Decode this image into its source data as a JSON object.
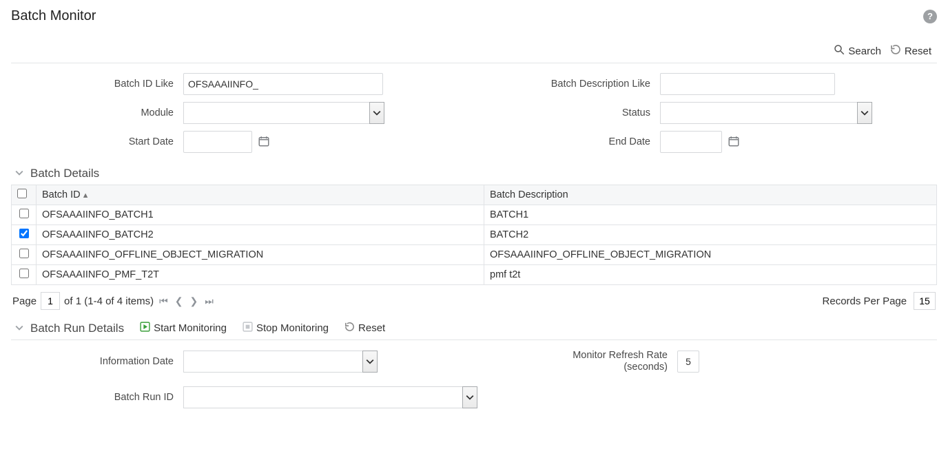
{
  "page": {
    "title": "Batch Monitor",
    "help_tooltip": "?"
  },
  "toolbar": {
    "search_label": "Search",
    "reset_label": "Reset"
  },
  "filters": {
    "batch_id_like_label": "Batch ID Like",
    "batch_id_like_value": "OFSAAAIINFO_",
    "batch_desc_like_label": "Batch Description Like",
    "batch_desc_like_value": "",
    "module_label": "Module",
    "module_value": "",
    "status_label": "Status",
    "status_value": "",
    "start_date_label": "Start Date",
    "start_date_value": "",
    "end_date_label": "End Date",
    "end_date_value": ""
  },
  "batch_details": {
    "title": "Batch Details",
    "columns": {
      "batch_id": "Batch ID",
      "batch_desc": "Batch Description"
    },
    "rows": [
      {
        "checked": false,
        "batch_id": "OFSAAAIINFO_BATCH1",
        "batch_desc": "BATCH1"
      },
      {
        "checked": true,
        "batch_id": "OFSAAAIINFO_BATCH2",
        "batch_desc": "BATCH2"
      },
      {
        "checked": false,
        "batch_id": "OFSAAAIINFO_OFFLINE_OBJECT_MIGRATION",
        "batch_desc": "OFSAAAIINFO_OFFLINE_OBJECT_MIGRATION"
      },
      {
        "checked": false,
        "batch_id": "OFSAAAIINFO_PMF_T2T",
        "batch_desc": "pmf t2t"
      }
    ]
  },
  "pager": {
    "page_label": "Page",
    "page_value": "1",
    "of_text": "of 1 (1-4 of 4 items)",
    "records_per_page_label": "Records Per Page",
    "records_per_page_value": "15"
  },
  "batch_run": {
    "title": "Batch Run Details",
    "start_label": "Start Monitoring",
    "stop_label": "Stop Monitoring",
    "reset_label": "Reset",
    "info_date_label": "Information Date",
    "info_date_value": "",
    "refresh_label_line1": "Monitor Refresh Rate",
    "refresh_label_line2": "(seconds)",
    "refresh_value": "5",
    "batch_run_id_label": "Batch Run ID",
    "batch_run_id_value": ""
  }
}
